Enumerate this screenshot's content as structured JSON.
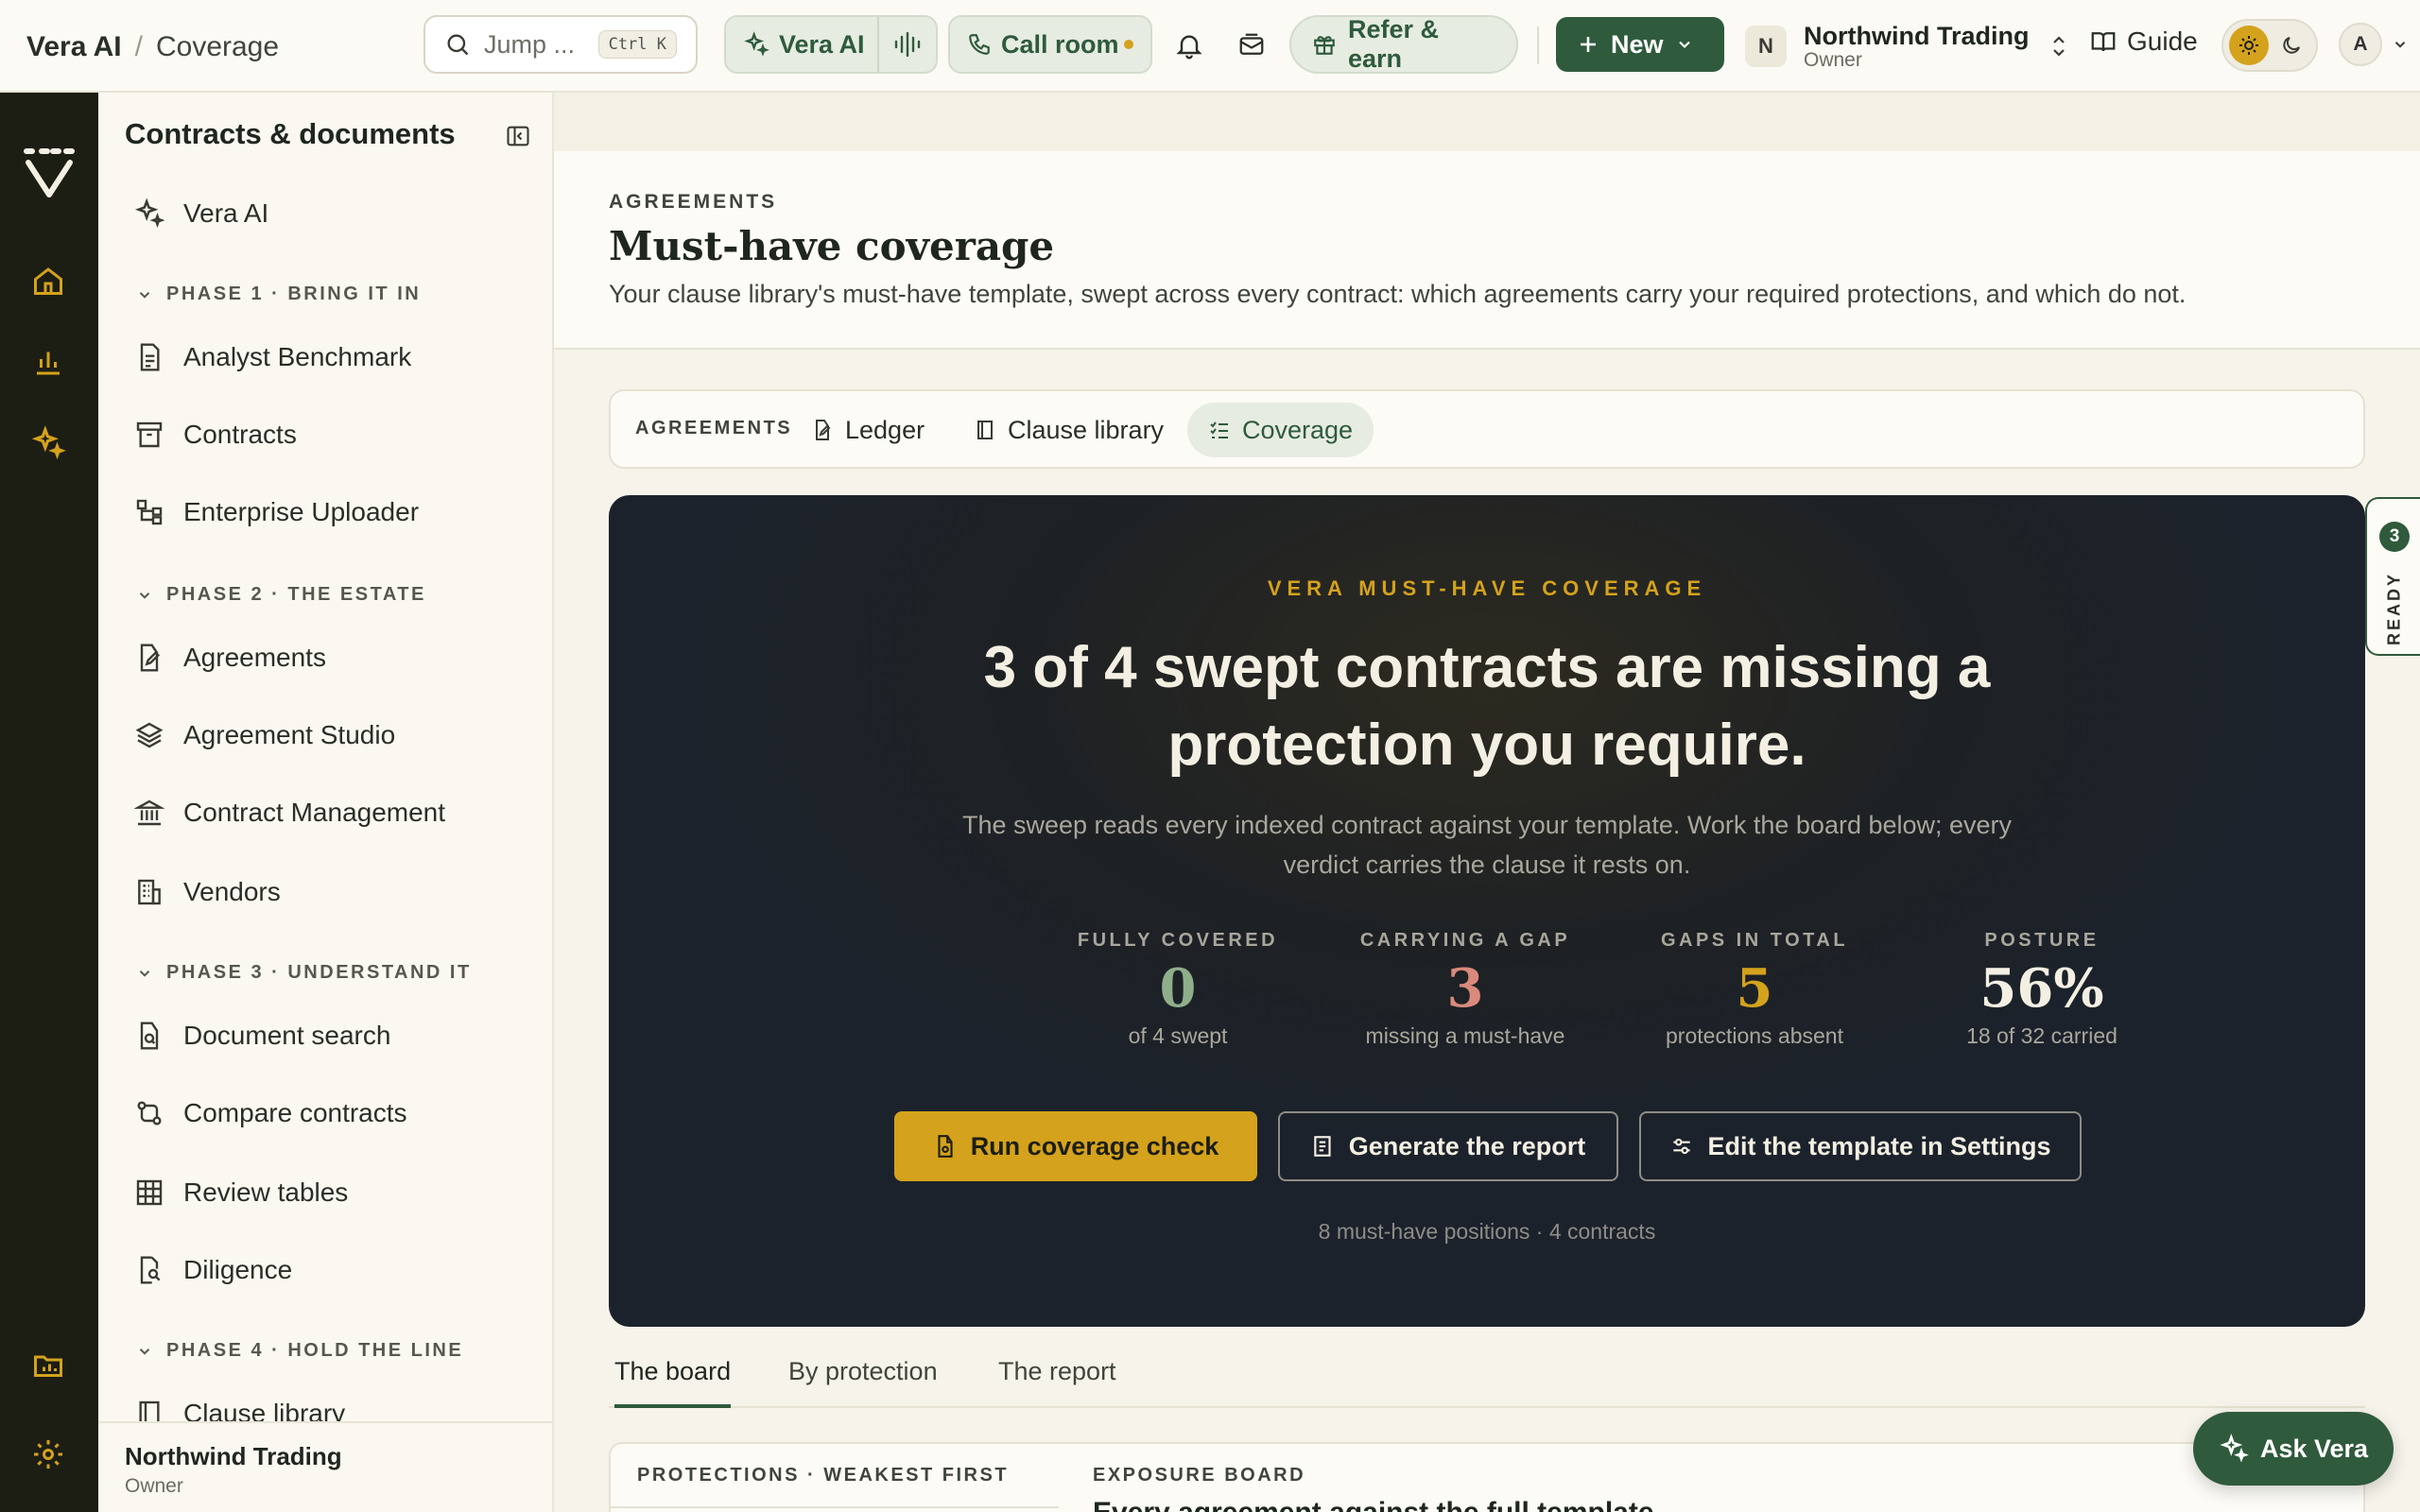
{
  "header": {
    "breadcrumb_root": "Vera AI",
    "breadcrumb_sep": "/",
    "breadcrumb_current": "Coverage",
    "search_label": "Jump ...",
    "search_shortcut": "Ctrl K",
    "vera_ai_label": "Vera AI",
    "call_room_label": "Call room",
    "refer_label": "Refer & earn",
    "new_label": "New",
    "org_initial": "N",
    "org_name": "Northwind Trading",
    "org_role": "Owner",
    "guide_label": "Guide",
    "user_initial": "A"
  },
  "sidebar": {
    "title": "Contracts & documents",
    "top_item": "Vera AI",
    "phase1": {
      "label": "PHASE 1 · BRING IT IN",
      "items": [
        "Analyst Benchmark",
        "Contracts",
        "Enterprise Uploader"
      ]
    },
    "phase2": {
      "label": "PHASE 2 · THE ESTATE",
      "items": [
        "Agreements",
        "Agreement Studio",
        "Contract Management",
        "Vendors"
      ]
    },
    "phase3": {
      "label": "PHASE 3 · UNDERSTAND IT",
      "items": [
        "Document search",
        "Compare contracts",
        "Review tables",
        "Diligence"
      ]
    },
    "phase4": {
      "label": "PHASE 4 · HOLD THE LINE",
      "items": [
        "Clause library"
      ]
    },
    "footer_name": "Northwind Trading",
    "footer_role": "Owner"
  },
  "page": {
    "eyebrow": "AGREEMENTS",
    "title": "Must-have coverage",
    "subtitle": "Your clause library's must-have template, swept across every contract: which agreements carry your required protections, and which do not."
  },
  "tabs": {
    "eyebrow": "AGREEMENTS",
    "items": [
      "Ledger",
      "Clause library",
      "Coverage"
    ],
    "active": "Coverage"
  },
  "hero": {
    "eyebrow": "VERA MUST-HAVE COVERAGE",
    "headline": "3 of 4 swept contracts are missing a protection you require.",
    "body": "The sweep reads every indexed contract against your template. Work the board below; every verdict carries the clause it rests on.",
    "stats": [
      {
        "label": "FULLY COVERED",
        "value": "0",
        "caption": "of 4 swept",
        "color": "#8fae8a"
      },
      {
        "label": "CARRYING A GAP",
        "value": "3",
        "caption": "missing a must-have",
        "color": "#d98a7c"
      },
      {
        "label": "GAPS IN TOTAL",
        "value": "5",
        "caption": "protections absent",
        "color": "#d4a21c"
      },
      {
        "label": "POSTURE",
        "value": "56%",
        "caption": "18 of 32 carried",
        "color": "#f3efe2"
      }
    ],
    "buttons": {
      "run": "Run coverage check",
      "report": "Generate the report",
      "edit": "Edit the template in Settings"
    },
    "footnote": "8 must-have positions · 4 contracts"
  },
  "ready_tab": {
    "count": "3",
    "label": "READY"
  },
  "subtabs": {
    "items": [
      "The board",
      "By protection",
      "The report"
    ],
    "active": "The board"
  },
  "board": {
    "left_label": "PROTECTIONS · WEAKEST FIRST",
    "right_label": "EXPOSURE BOARD",
    "right_title": "Every agreement against the full template"
  },
  "ask_vera": "Ask Vera",
  "colors": {
    "accent_green": "#2f5a3c",
    "accent_gold": "#d4a21c",
    "rail": "#1c1e14"
  }
}
